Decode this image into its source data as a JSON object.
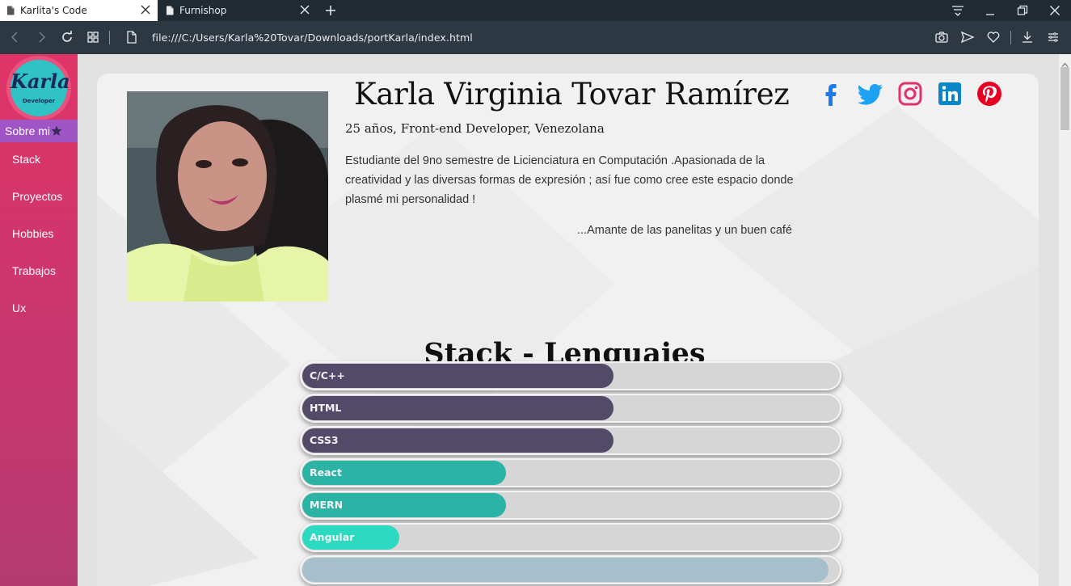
{
  "browser": {
    "tabs": [
      {
        "title": "Karlita's Code",
        "active": true
      },
      {
        "title": "Furnishop",
        "active": false
      }
    ],
    "url": "file:///C:/Users/Karla%20Tovar/Downloads/portKarla/index.html"
  },
  "sidebar": {
    "logo_text": "Karla",
    "logo_subtext": "Developer",
    "items": [
      {
        "label": "Sobre mi",
        "active": true
      },
      {
        "label": "Stack"
      },
      {
        "label": "Proyectos"
      },
      {
        "label": "Hobbies"
      },
      {
        "label": "Trabajos"
      },
      {
        "label": "Ux"
      }
    ]
  },
  "profile": {
    "name": "Karla Virginia Tovar Ramírez",
    "subtitle": "25 años, Front-end Developer, Venezolana",
    "bio": "Estudiante del 9no semestre de Licienciatura en Computación .Apasionada de la creatividad y las diversas formas de expresión ; así fue como cree este espacio donde plasmé mi personalidad !",
    "quote": "...Amante de las panelitas y un buen café"
  },
  "social": [
    {
      "name": "facebook-icon",
      "color": "#1877f2"
    },
    {
      "name": "twitter-icon",
      "color": "#1da1f2"
    },
    {
      "name": "instagram-icon",
      "color": "#e1306c"
    },
    {
      "name": "linkedin-icon",
      "color": "#0a86c8"
    },
    {
      "name": "pinterest-icon",
      "color": "#e60023"
    }
  ],
  "stack": {
    "title": "Stack - Lenguajes",
    "skills": [
      {
        "label": "C/C++",
        "level": 0.58,
        "color": "#524a68"
      },
      {
        "label": "HTML",
        "level": 0.58,
        "color": "#524a68"
      },
      {
        "label": "CSS3",
        "level": 0.58,
        "color": "#524a68"
      },
      {
        "label": "React",
        "level": 0.38,
        "color": "#2bb3a6"
      },
      {
        "label": "MERN",
        "level": 0.38,
        "color": "#2bb3a6"
      },
      {
        "label": "Angular",
        "level": 0.18,
        "color": "#2cdac2"
      },
      {
        "label": "",
        "level": 0.98,
        "color": "#a6bfcc"
      }
    ]
  }
}
